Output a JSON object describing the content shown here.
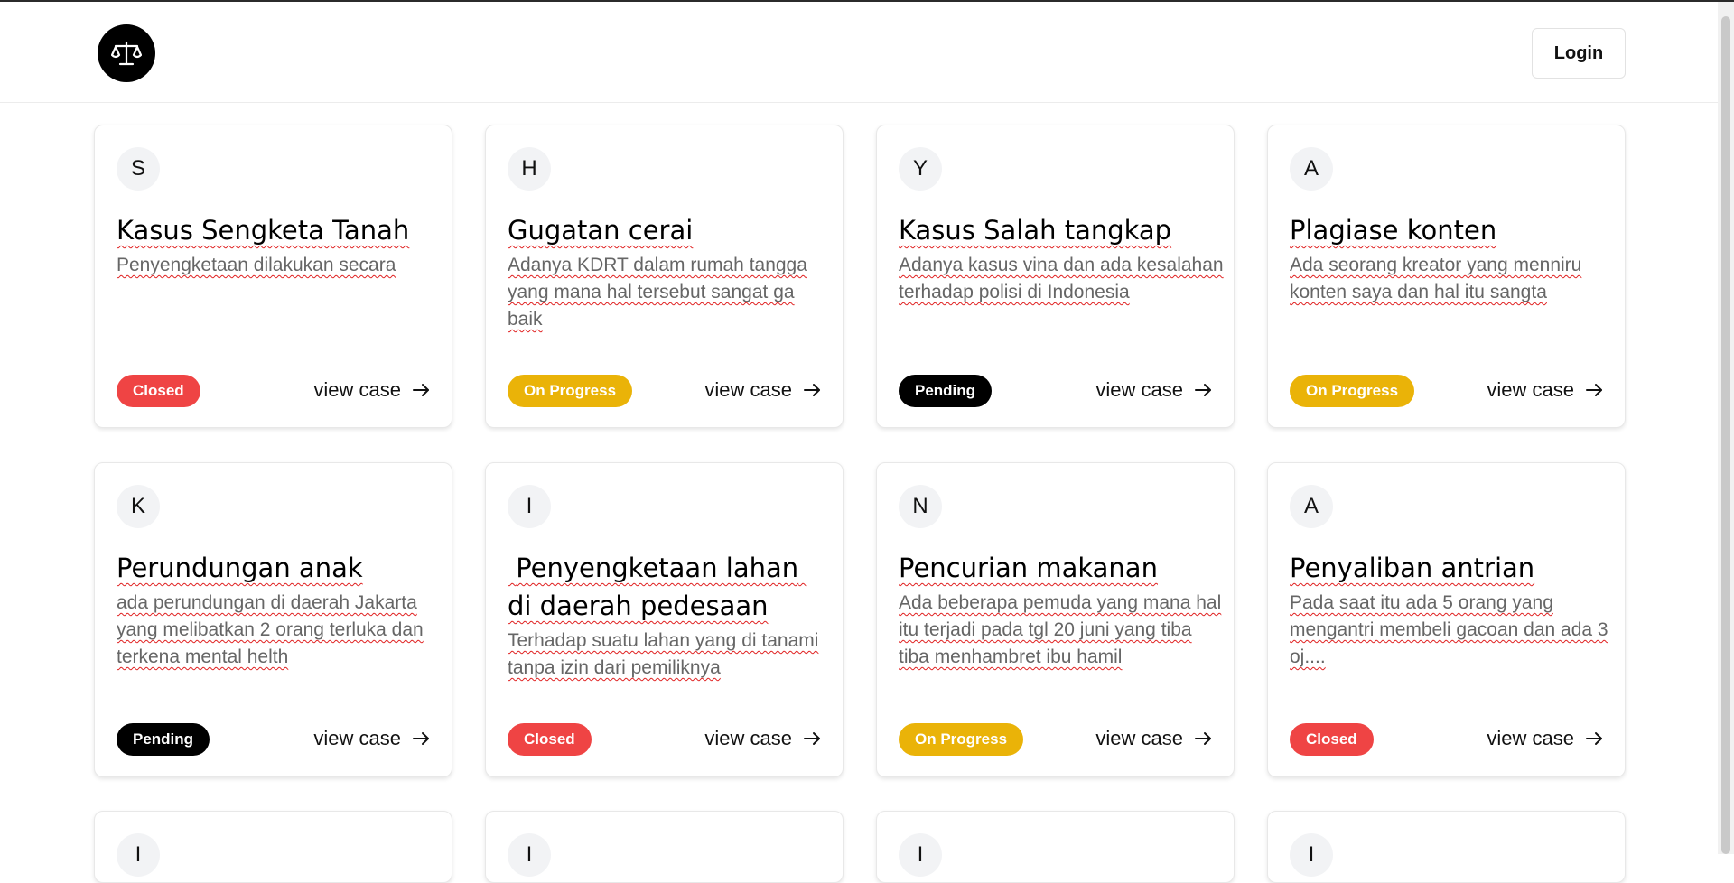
{
  "header": {
    "logo_icon": "scales-of-justice-icon",
    "login_label": "Login"
  },
  "cards": [
    {
      "initial": "S",
      "title": "Kasus Sengketa Tanah",
      "description": "Penyengketaan dilakukan secara",
      "status": "Closed",
      "status_color": "#ef4444",
      "link": "view case"
    },
    {
      "initial": "H",
      "title": "Gugatan cerai",
      "description": "Adanya KDRT dalam rumah tangga yang mana hal tersebut sangat ga baik",
      "status": "On Progress",
      "status_color": "#eab308",
      "link": "view case"
    },
    {
      "initial": "Y",
      "title": "Kasus Salah tangkap",
      "description": "Adanya kasus vina dan ada kesalahan terhadap polisi di Indonesia",
      "status": "Pending",
      "status_color": "#000000",
      "link": "view case"
    },
    {
      "initial": "A",
      "title": "Plagiase konten",
      "description": "Ada seorang kreator yang menniru konten saya dan hal itu sangta",
      "status": "On Progress",
      "status_color": "#eab308",
      "link": "view case"
    },
    {
      "initial": "K",
      "title": "Perundungan anak",
      "description": "ada perundungan di daerah Jakarta yang melibatkan 2  orang terluka dan terkena mental helth",
      "status": "Pending",
      "status_color": "#000000",
      "link": "view case"
    },
    {
      "initial": "I",
      "title": " Penyengketaan lahan di daerah pedesaan",
      "description": "Terhadap suatu lahan yang di tanami tanpa izin dari pemiliknya",
      "status": "Closed",
      "status_color": "#ef4444",
      "link": "view case"
    },
    {
      "initial": "N",
      "title": "Pencurian makanan",
      "description": "Ada beberapa pemuda yang mana hal itu terjadi pada tgl 20 juni yang tiba tiba menhambret ibu hamil",
      "status": "On Progress",
      "status_color": "#eab308",
      "link": "view case"
    },
    {
      "initial": "A",
      "title": "Penyaliban antrian",
      "description": "Pada saat itu ada 5 orang yang mengantri membeli gacoan dan ada 3 oj....",
      "status": "Closed",
      "status_color": "#ef4444",
      "link": "view case"
    }
  ],
  "next_row_initials": [
    "I",
    "I",
    "I",
    "I"
  ]
}
